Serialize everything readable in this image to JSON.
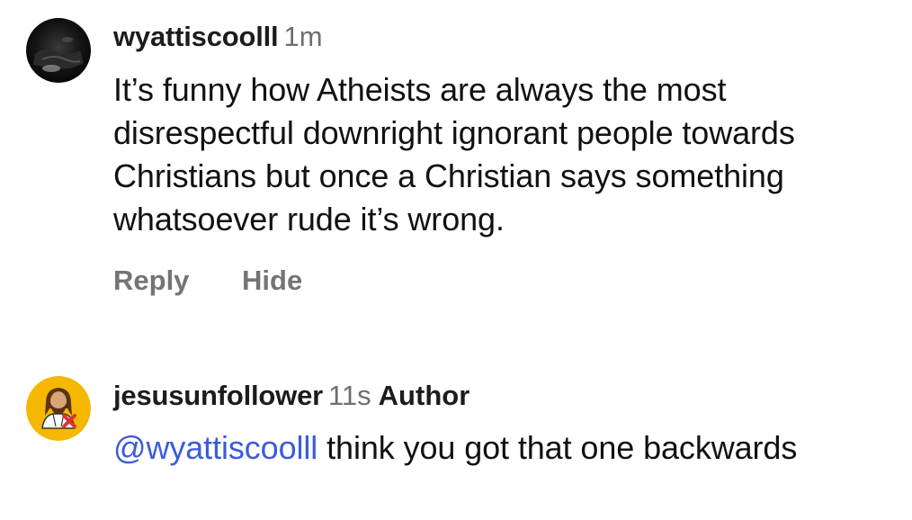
{
  "comments": [
    {
      "username": "wyattiscoolll",
      "timestamp": "1m",
      "text": "It’s funny how Atheists are always the most disrespectful downright ignorant people towards Christians but once a Christian says something whatsoever rude it’s wrong.",
      "avatar_icon": "dark-photo-avatar",
      "actions": {
        "reply": "Reply",
        "hide": "Hide"
      }
    },
    {
      "username": "jesusunfollower",
      "timestamp": "11s",
      "badge": "Author",
      "mention": "@wyattiscoolll",
      "text": " think you got that one backwards",
      "avatar_icon": "jesus-unfollow-avatar"
    }
  ],
  "colors": {
    "mention": "#3b5bdb",
    "secondary_text": "#6e6e73",
    "action_text": "#737378",
    "avatar_bg_yellow": "#f5b700",
    "unfollow_x_red": "#e03131"
  }
}
